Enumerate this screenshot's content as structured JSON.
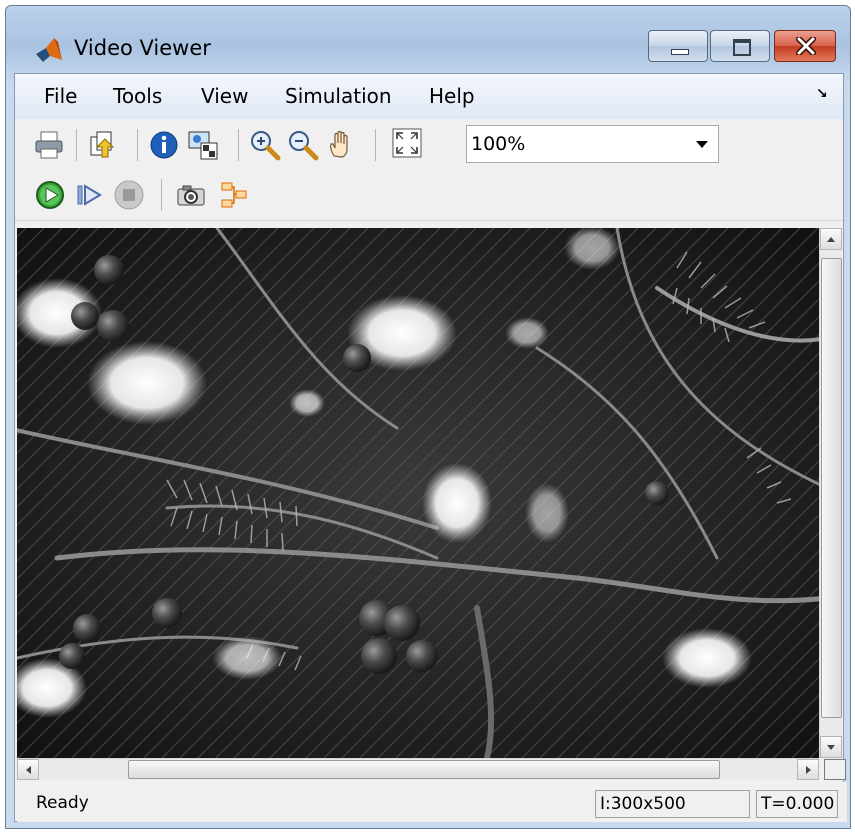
{
  "window": {
    "title": "Video Viewer"
  },
  "menu": {
    "items": [
      "File",
      "Tools",
      "View",
      "Simulation",
      "Help"
    ],
    "dock_arrow": "↘"
  },
  "toolbar1": {
    "icons": [
      "print-icon",
      "bring-all-to-front-icon",
      "info-icon",
      "pixel-region-icon",
      "zoom-in-icon",
      "zoom-out-icon",
      "pan-hand-icon",
      "fit-to-view-icon"
    ],
    "zoom_value": "100%"
  },
  "toolbar2": {
    "icons": [
      "start-simulation-icon",
      "step-forward-icon",
      "stop-simulation-icon",
      "snapshot-camera-icon",
      "highlight-block-icon"
    ]
  },
  "video": {
    "content": "grayscale frame of evergreen branches with snow and berries"
  },
  "status": {
    "text": "Ready",
    "image_size": "I:300x500",
    "time": "T=0.000"
  },
  "colors": {
    "accent_green": "#3aa53a",
    "close_red": "#c43a22",
    "titlebar_blue": "#b5cce8"
  }
}
